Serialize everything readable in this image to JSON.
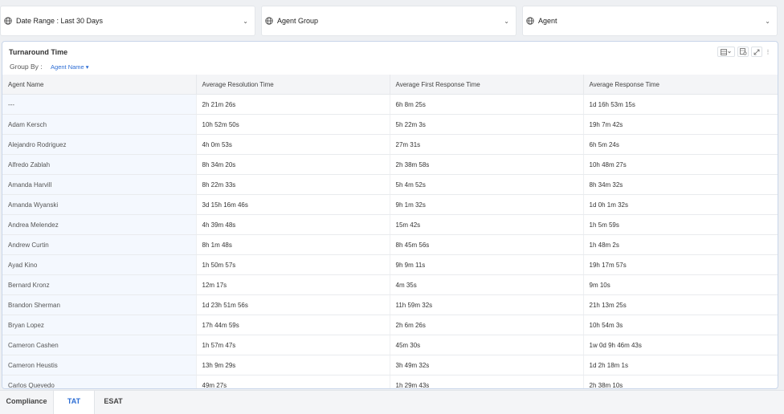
{
  "filters": [
    {
      "label": "Date Range :  Last 30 Days"
    },
    {
      "label": "Agent Group"
    },
    {
      "label": "Agent"
    }
  ],
  "panel": {
    "title": "Turnaround Time",
    "group_by_label": "Group By :",
    "group_by_value": "Agent Name ▾"
  },
  "table": {
    "headers": [
      "Agent Name",
      "Average Resolution Time",
      "Average First Response Time",
      "Average Response Time"
    ],
    "rows": [
      [
        "---",
        "2h 21m 26s",
        "6h 8m 25s",
        "1d 16h 53m 15s"
      ],
      [
        "Adam Kersch",
        "10h 52m 50s",
        "5h 22m 3s",
        "19h 7m 42s"
      ],
      [
        "Alejandro Rodriguez",
        "4h 0m 53s",
        "27m 31s",
        "6h 5m 24s"
      ],
      [
        "Alfredo Zablah",
        "8h 34m 20s",
        "2h 38m 58s",
        "10h 48m 27s"
      ],
      [
        "Amanda Harvill",
        "8h 22m 33s",
        "5h 4m 52s",
        "8h 34m 32s"
      ],
      [
        "Amanda Wyanski",
        "3d 15h 16m 46s",
        "9h 1m 32s",
        "1d 0h 1m 32s"
      ],
      [
        "Andrea Melendez",
        "4h 39m 48s",
        "15m 42s",
        "1h 5m 59s"
      ],
      [
        "Andrew Curtin",
        "8h 1m 48s",
        "8h 45m 56s",
        "1h 48m 2s"
      ],
      [
        "Ayad Kino",
        "1h 50m 57s",
        "9h 9m 11s",
        "19h 17m 57s"
      ],
      [
        "Bernard Kronz",
        "12m 17s",
        "4m 35s",
        "9m 10s"
      ],
      [
        "Brandon Sherman",
        "1d 23h 51m 56s",
        "11h 59m 32s",
        "21h 13m 25s"
      ],
      [
        "Bryan Lopez",
        "17h 44m 59s",
        "2h 6m 26s",
        "10h 54m 3s"
      ],
      [
        "Cameron Cashen",
        "1h 57m 47s",
        "45m 30s",
        "1w 0d 9h 46m 43s"
      ],
      [
        "Cameron Heustis",
        "13h 9m 29s",
        "3h 49m 32s",
        "1d 2h 18m 1s"
      ],
      [
        "Carlos Quevedo",
        "49m 27s",
        "1h 29m 43s",
        "2h 38m 10s"
      ]
    ]
  },
  "tabs": [
    {
      "label": "Compliance",
      "active": false
    },
    {
      "label": "TAT",
      "active": true
    },
    {
      "label": "ESAT",
      "active": false
    }
  ],
  "colors": {
    "accent": "#2b6cd4",
    "panel_border": "#c9d6ea"
  }
}
